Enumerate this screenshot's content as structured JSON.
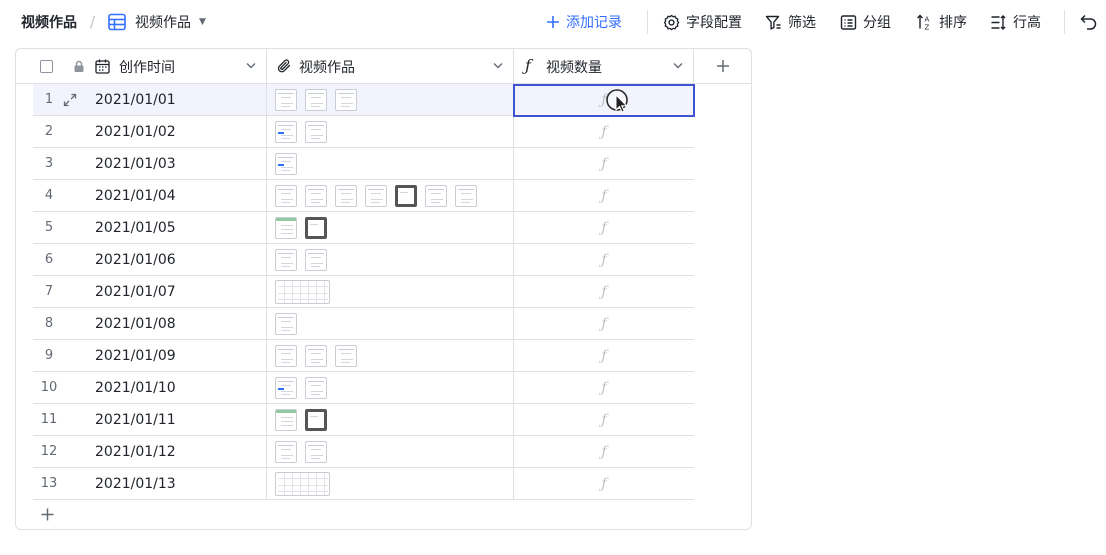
{
  "breadcrumb": {
    "root": "视频作品",
    "view": "视频作品"
  },
  "toolbar": {
    "add_record": "添加记录",
    "field_config": "字段配置",
    "filter": "筛选",
    "group": "分组",
    "sort": "排序",
    "row_height": "行高",
    "accent_color": "#3370ff"
  },
  "table": {
    "columns": [
      {
        "name": "创作时间",
        "type": "date"
      },
      {
        "name": "视频作品",
        "type": "attachment"
      },
      {
        "name": "视频数量",
        "type": "formula"
      }
    ],
    "formula_glyph": "ƒ",
    "selected_row": 1,
    "selection_color": "#3e53ce",
    "rows": [
      {
        "num": "1",
        "date": "2021/01/01",
        "thumbs": [
          "doc",
          "doc",
          "doc"
        ]
      },
      {
        "num": "2",
        "date": "2021/01/02",
        "thumbs": [
          "blue",
          "doc"
        ]
      },
      {
        "num": "3",
        "date": "2021/01/03",
        "thumbs": [
          "blue"
        ]
      },
      {
        "num": "4",
        "date": "2021/01/04",
        "thumbs": [
          "doc",
          "doc",
          "doc",
          "doc",
          "dark",
          "doc",
          "doc"
        ]
      },
      {
        "num": "5",
        "date": "2021/01/05",
        "thumbs": [
          "green",
          "dark"
        ]
      },
      {
        "num": "6",
        "date": "2021/01/06",
        "thumbs": [
          "doc",
          "doc"
        ]
      },
      {
        "num": "7",
        "date": "2021/01/07",
        "thumbs": [
          "wide"
        ]
      },
      {
        "num": "8",
        "date": "2021/01/08",
        "thumbs": [
          "doc"
        ]
      },
      {
        "num": "9",
        "date": "2021/01/09",
        "thumbs": [
          "doc",
          "doc",
          "doc"
        ]
      },
      {
        "num": "10",
        "date": "2021/01/10",
        "thumbs": [
          "blue",
          "doc"
        ]
      },
      {
        "num": "11",
        "date": "2021/01/11",
        "thumbs": [
          "green",
          "dark"
        ]
      },
      {
        "num": "12",
        "date": "2021/01/12",
        "thumbs": [
          "doc",
          "doc"
        ]
      },
      {
        "num": "13",
        "date": "2021/01/13",
        "thumbs": [
          "wide"
        ]
      }
    ]
  }
}
